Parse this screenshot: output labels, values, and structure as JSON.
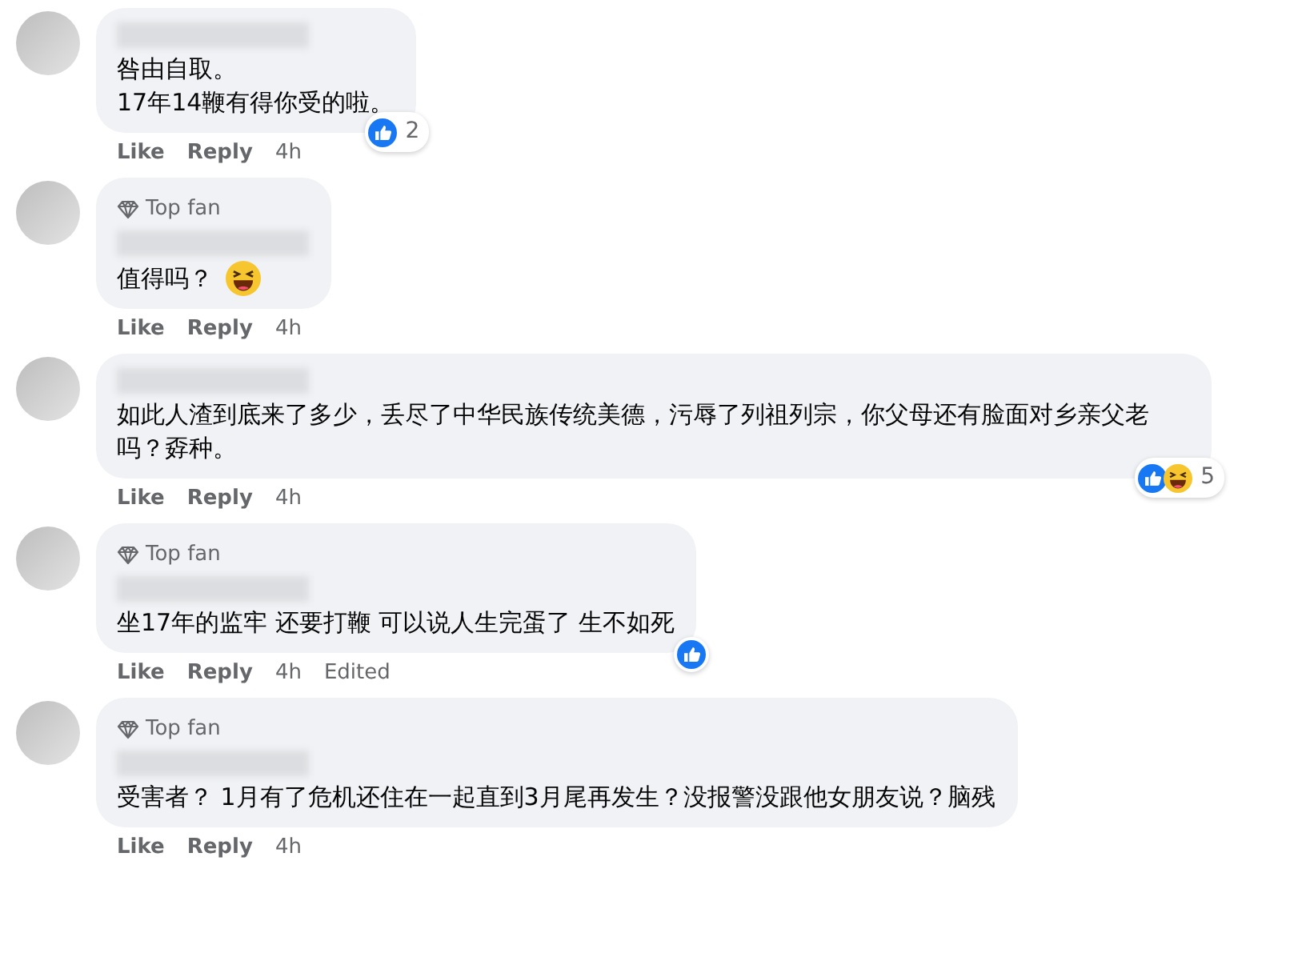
{
  "comments": [
    {
      "text": "咎由自取。\n17年14鞭有得你受的啦。",
      "reactions": {
        "icons": [
          {
            "kind": "like"
          }
        ],
        "count": "2"
      },
      "actions": [
        "Like",
        "Reply"
      ],
      "time": "4h"
    },
    {
      "badge": "Top fan",
      "text": "值得吗？",
      "inline_emoji": {
        "kind": "haha"
      },
      "actions": [
        "Like",
        "Reply"
      ],
      "time": "4h"
    },
    {
      "text": "如此人渣到底来了多少，丢尽了中华民族传统美德，污辱了列祖列宗，你父母还有脸面对乡亲父老吗？孬种。",
      "reactions": {
        "icons": [
          {
            "kind": "like"
          },
          {
            "kind": "haha"
          }
        ],
        "count": "5"
      },
      "actions": [
        "Like",
        "Reply"
      ],
      "time": "4h"
    },
    {
      "badge": "Top fan",
      "text": "坐17年的监牢 还要打鞭 可以说人生完蛋了 生不如死",
      "reactions": {
        "icons": [
          {
            "kind": "like"
          }
        ]
      },
      "actions": [
        "Like",
        "Reply"
      ],
      "time": "4h",
      "edited": "Edited"
    },
    {
      "badge": "Top fan",
      "text": "受害者？ 1月有了危机还住在一起直到3月尾再发生？没报警没跟他女朋友说？脑残",
      "actions": [
        "Like",
        "Reply"
      ],
      "time": "4h"
    }
  ]
}
